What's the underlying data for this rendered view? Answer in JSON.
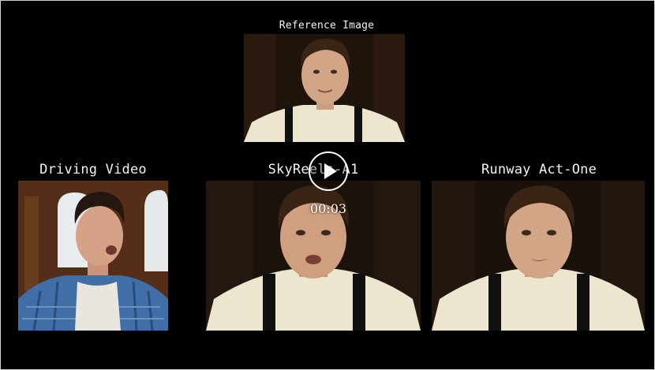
{
  "video": {
    "labels": {
      "reference": "Reference Image",
      "driving": "Driving Video",
      "skyreels": "SkyReels-A1",
      "runway": "Runway Act-One"
    },
    "elapsed_time": "00:03"
  },
  "colors": {
    "background": "#000000",
    "label_text": "#f2f2f2",
    "shirt_cream": "#ece6cf",
    "plaid_blue": "#3f6fa6"
  }
}
